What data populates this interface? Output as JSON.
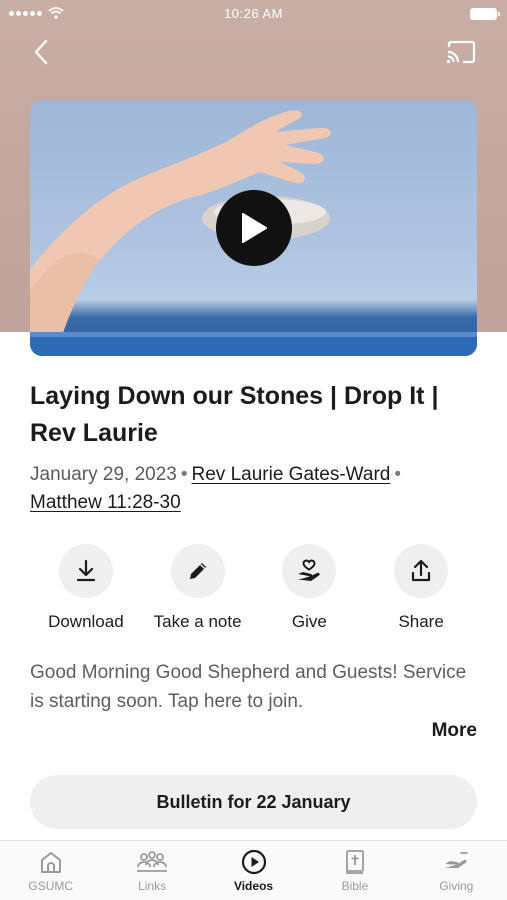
{
  "status_bar": {
    "time": "10:26 AM"
  },
  "sermon": {
    "title": "Laying Down our Stones | Drop It | Rev Laurie",
    "date": "January 29, 2023",
    "speaker": "Rev Laurie Gates-Ward",
    "scripture": "Matthew 11:28-30",
    "separator": "•"
  },
  "actions": [
    {
      "label": "Download",
      "icon": "download-icon"
    },
    {
      "label": "Take a note",
      "icon": "pencil-icon"
    },
    {
      "label": "Give",
      "icon": "giving-hand-icon"
    },
    {
      "label": "Share",
      "icon": "share-icon"
    }
  ],
  "description": {
    "text": "Good Morning Good Shepherd and Guests! Service is starting soon. Tap here to join.",
    "more_label": "More"
  },
  "bulletin": {
    "label": "Bulletin for 22 January"
  },
  "tabs": [
    {
      "label": "GSUMC",
      "icon": "church-icon",
      "active": false
    },
    {
      "label": "Links",
      "icon": "people-icon",
      "active": false
    },
    {
      "label": "Videos",
      "icon": "play-circle-icon",
      "active": true
    },
    {
      "label": "Bible",
      "icon": "bible-icon",
      "active": false
    },
    {
      "label": "Giving",
      "icon": "giving-icon",
      "active": false
    }
  ],
  "colors": {
    "hero_background": "#c3a69e",
    "accent": "#1c1c1e",
    "muted": "#9a9a9a"
  }
}
